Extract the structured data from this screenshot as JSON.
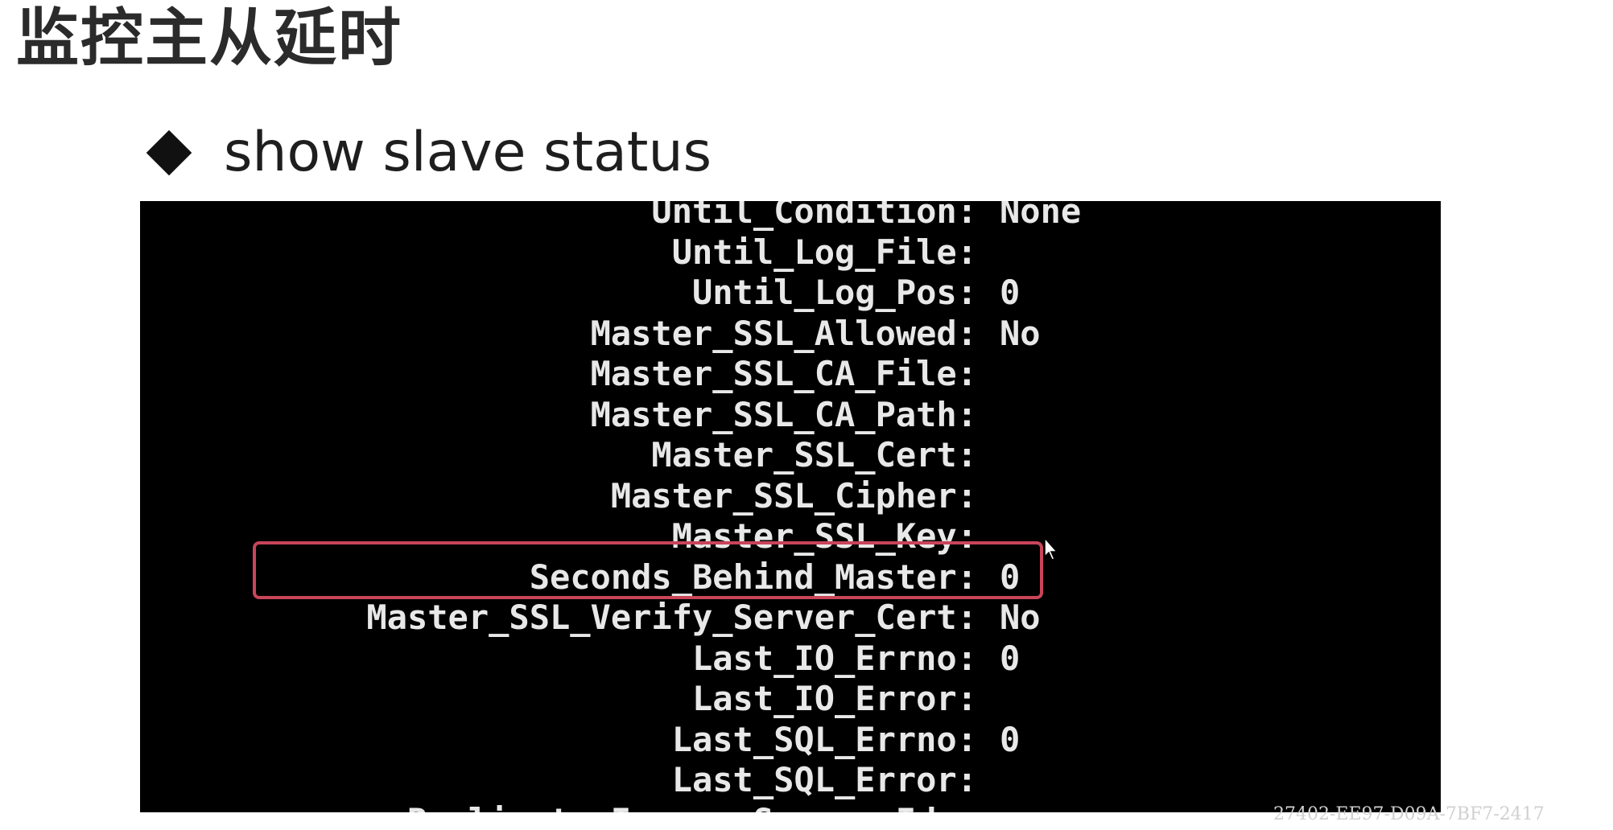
{
  "slide": {
    "title": "监控主从延时",
    "bullet": "show slave status"
  },
  "terminal": {
    "lines": [
      {
        "key": "Until_Condition:",
        "value": "None"
      },
      {
        "key": "Until_Log_File:",
        "value": ""
      },
      {
        "key": "Until_Log_Pos:",
        "value": "0"
      },
      {
        "key": "Master_SSL_Allowed:",
        "value": "No"
      },
      {
        "key": "Master_SSL_CA_File:",
        "value": ""
      },
      {
        "key": "Master_SSL_CA_Path:",
        "value": ""
      },
      {
        "key": "Master_SSL_Cert:",
        "value": ""
      },
      {
        "key": "Master_SSL_Cipher:",
        "value": ""
      },
      {
        "key": "Master_SSL_Key:",
        "value": ""
      },
      {
        "key": "Seconds_Behind_Master:",
        "value": "0"
      },
      {
        "key": "Master_SSL_Verify_Server_Cert:",
        "value": "No"
      },
      {
        "key": "Last_IO_Errno:",
        "value": "0"
      },
      {
        "key": "Last_IO_Error:",
        "value": ""
      },
      {
        "key": "Last_SQL_Errno:",
        "value": "0"
      },
      {
        "key": "Last_SQL_Error:",
        "value": ""
      },
      {
        "key": "Replicate_Ignore_Server_Ids:",
        "value": ""
      }
    ]
  },
  "highlight": {
    "color": "#c9455a"
  },
  "watermark": "27402-EE97-D09A-7BF7-2417"
}
